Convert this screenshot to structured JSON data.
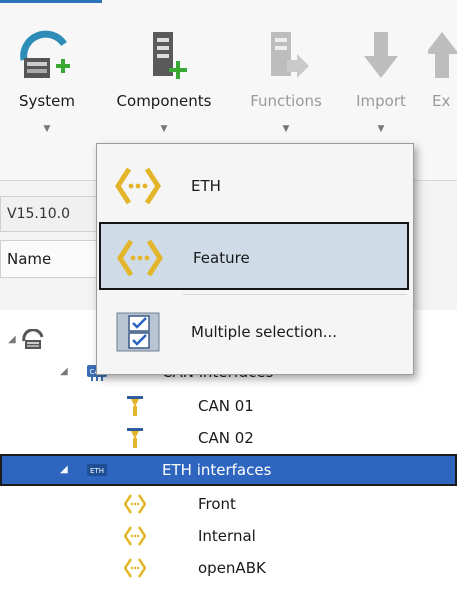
{
  "ribbon": {
    "buttons": [
      {
        "label": "System",
        "icon": "system-add-icon",
        "enabled": true
      },
      {
        "label": "Components",
        "icon": "components-add-icon",
        "enabled": true
      },
      {
        "label": "Functions",
        "icon": "functions-icon",
        "enabled": false
      },
      {
        "label": "Import",
        "icon": "import-arrow-icon",
        "enabled": false
      },
      {
        "label": "Ex",
        "icon": "export-icon",
        "enabled": false
      }
    ]
  },
  "version": "V15.10.0",
  "column_header": "Name",
  "dropdown": {
    "items": [
      {
        "label": "ETH",
        "icon": "eth-diamond-icon"
      },
      {
        "label": "Feature",
        "icon": "feature-diamond-icon"
      },
      {
        "label": "Multiple selection...",
        "icon": "multiple-selection-icon"
      }
    ]
  },
  "tree": {
    "rows": [
      {
        "label": "",
        "icon": "device-icon"
      },
      {
        "label": "CAN interfaces",
        "icon": "can-icon"
      },
      {
        "label": "CAN 01",
        "icon": "can-connector-icon"
      },
      {
        "label": "CAN 02",
        "icon": "can-connector-icon"
      },
      {
        "label": "ETH interfaces",
        "icon": "eth-icon",
        "selected": true
      },
      {
        "label": "Front",
        "icon": "eth-diamond-icon"
      },
      {
        "label": "Internal",
        "icon": "eth-diamond-icon"
      },
      {
        "label": "openABK",
        "icon": "eth-diamond-icon"
      }
    ]
  },
  "colors": {
    "selection": "#2e66bf",
    "menu_hover": "#cfdbe6",
    "diamond": "#e3b52a",
    "ribbon_accent": "#2b73b8"
  }
}
